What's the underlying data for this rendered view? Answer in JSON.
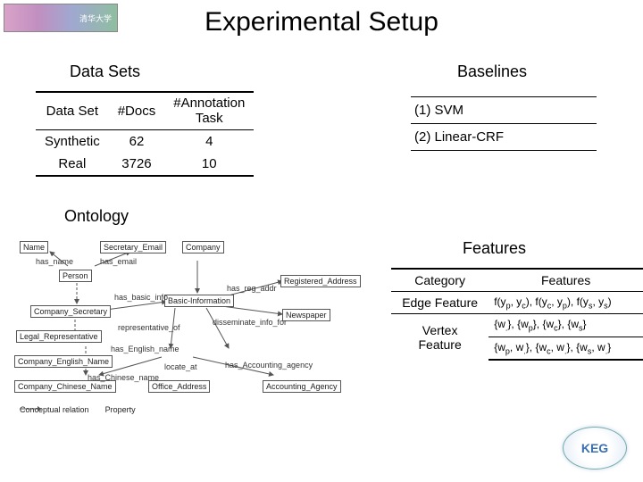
{
  "title": "Experimental Setup",
  "section_labels": {
    "data_sets": "Data Sets",
    "baselines": "Baselines",
    "ontology": "Ontology",
    "features": "Features"
  },
  "datasets_table": {
    "headers": [
      "Data Set",
      "#Docs",
      "#Annotation Task"
    ],
    "rows": [
      {
        "name": "Synthetic",
        "docs": "62",
        "tasks": "4"
      },
      {
        "name": "Real",
        "docs": "3726",
        "tasks": "10"
      }
    ]
  },
  "baselines": [
    "(1) SVM",
    "(2) Linear-CRF"
  ],
  "features_table": {
    "headers": [
      "Category",
      "Features"
    ],
    "rows": [
      {
        "category": "Edge Feature",
        "features": "f(yₚ, y_c), f(y_c, yₚ), f(yₛ, yₛ)"
      },
      {
        "category": "Vertex Feature",
        "features_a": "{w.}, {wₚ}, {w_c}, {wₛ}",
        "features_b": "{wₚ, w.}, {w_c, w.}, {wₛ, w.}"
      }
    ]
  },
  "ontology": {
    "nodes": {
      "name": "Name",
      "secretary_email": "Secretary_Email",
      "company": "Company",
      "person": "Person",
      "registered_addr": "Registered_Address",
      "newspaper": "Newspaper",
      "legal_rep": "Legal_Representative",
      "basic_info": "Basic-Information",
      "company_secretary": "Company_Secretary",
      "company_english": "Company_English_Name",
      "company_chinese": "Company_Chinese_Name",
      "office_addr": "Office_Address",
      "accounting_agency": "Accounting_Agency"
    },
    "rels": {
      "has_name": "has_name",
      "has_email": "has_email",
      "has_basic_info": "has_basic_info",
      "has_reg_addr": "has_reg_addr",
      "disseminate": "disseminate_info_for",
      "representative_of": "representative_of",
      "has_english": "has_English_name",
      "locate_at": "locate_at",
      "has_accounting": "has_Accounting_agency",
      "has_chinese": "has_Chinese_name",
      "conceptual": "Conceptual relation",
      "property": "Property"
    }
  },
  "logos": {
    "top_left": "清华大学",
    "bottom_right": "KEG"
  }
}
